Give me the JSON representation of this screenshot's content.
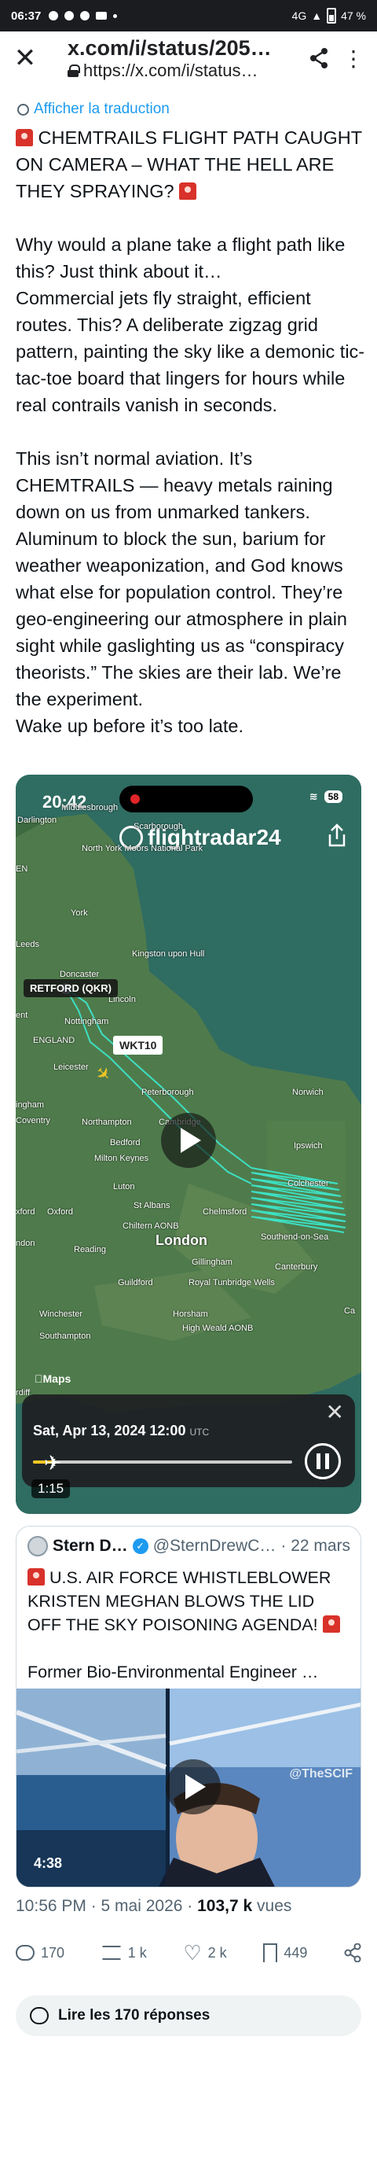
{
  "status_bar": {
    "time": "06:37",
    "network": "4G",
    "battery": "47 %"
  },
  "browser": {
    "page_title": "x.com/i/status/205…",
    "url": "https://x.com/i/status…"
  },
  "post": {
    "translate_label": "Afficher la traduction",
    "headline": "CHEMTRAILS FLIGHT PATH CAUGHT ON CAMERA – WHAT THE HELL ARE THEY SPRAYING?",
    "body": "Why would a plane take a flight path like this? Just think about it…\nCommercial jets fly straight, efficient routes. This? A deliberate zigzag grid pattern, painting the sky like a demonic tic-tac-toe board that lingers for hours while real contrails vanish in seconds.\n\nThis isn’t normal aviation. It’s CHEMTRAILS — heavy metals raining down on us from unmarked tankers. Aluminum to block the sun, barium for weather weaponization, and God knows what else for population control. They’re geo-engineering our atmosphere in plain sight while gaslighting us as “conspiracy theorists.” The skies are their lab. We’re the experiment.\nWake up before it’s too late.",
    "timestamp": "10:56 PM · 5 mai 2026 · ",
    "views_count": "103,7 k",
    "views_label": " vues"
  },
  "video": {
    "phone_time": "20:42",
    "phone_battery": "58",
    "app_name_a": "flightradar",
    "app_name_b": "24",
    "flight_label": "WKT10",
    "airport_label": "RETFORD (QKR)",
    "playback_date": "Sat, Apr 13, 2024 12:00",
    "playback_tz": "UTC",
    "playback_progress": 0.08,
    "duration": "1:15",
    "map_attribution": "Maps",
    "places": [
      "Middlesbrough",
      "Darlington",
      "Scarborough",
      "North York Moors National Park",
      "York",
      "Leeds",
      "Kingston upon Hull",
      "Doncaster",
      "Lincoln",
      "Nottingham",
      "ENGLAND",
      "Leicester",
      "Peterborough",
      "Norwich",
      "Coventry",
      "Northampton",
      "Cambridge",
      "Bedford",
      "Milton Keynes",
      "Ipswich",
      "Luton",
      "Colchester",
      "Oxford",
      "St Albans",
      "Chelmsford",
      "London",
      "Southend-on-Sea",
      "Reading",
      "Chiltern AONB",
      "Gillingham",
      "Guildford",
      "Royal Tunbridge Wells",
      "Canterbury",
      "Winchester",
      "Horsham",
      "High Weald AONB",
      "Southampton",
      "Ca",
      "EN",
      "ent",
      "ingham",
      "xford",
      "ndon",
      "rdiff"
    ]
  },
  "quoted": {
    "name": "Stern D…",
    "handle": "@SternDrewC…",
    "date": "· 22 mars",
    "headline": "U.S. AIR FORCE WHISTLEBLOWER KRISTEN MEGHAN BLOWS THE LID OFF THE SKY POISONING AGENDA!",
    "subtext": "Former Bio-Environmental Engineer …",
    "video_duration": "4:38",
    "watermark": "@TheSCIF"
  },
  "actions": {
    "replies": "170",
    "reposts": "1 k",
    "likes": "2 k",
    "bookmarks": "449"
  },
  "read_replies_label": "Lire les 170 réponses",
  "colors": {
    "link": "#1d9bf0",
    "flight_track": "#3de0c3",
    "map_land": "#4f7b4c",
    "map_sea": "#2f6c62"
  }
}
